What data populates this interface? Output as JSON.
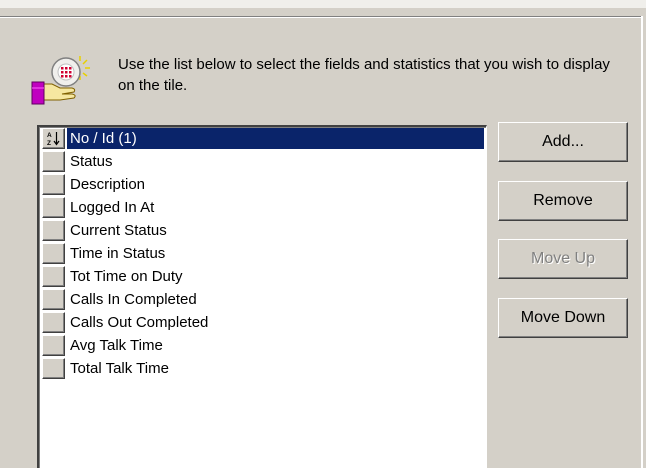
{
  "instructions": "Use the list below to select the fields and statistics that you wish to display on the tile.",
  "icons": {
    "wizard": "wizard-hand-icon",
    "sort": "sort-az-icon"
  },
  "list": {
    "items": [
      {
        "label": "No / Id (1)",
        "selected": true,
        "sorted": true
      },
      {
        "label": "Status",
        "selected": false
      },
      {
        "label": "Description",
        "selected": false
      },
      {
        "label": "Logged In At",
        "selected": false
      },
      {
        "label": "Current Status",
        "selected": false
      },
      {
        "label": "Time in Status",
        "selected": false
      },
      {
        "label": "Tot Time on Duty",
        "selected": false
      },
      {
        "label": "Calls In Completed",
        "selected": false
      },
      {
        "label": "Calls Out Completed",
        "selected": false
      },
      {
        "label": "Avg Talk Time",
        "selected": false
      },
      {
        "label": "Total Talk Time",
        "selected": false
      }
    ]
  },
  "buttons": {
    "add": "Add...",
    "remove": "Remove",
    "move_up": "Move Up",
    "move_down": "Move Down"
  },
  "colors": {
    "selection": "#0a246a",
    "face": "#d4d0c8"
  }
}
